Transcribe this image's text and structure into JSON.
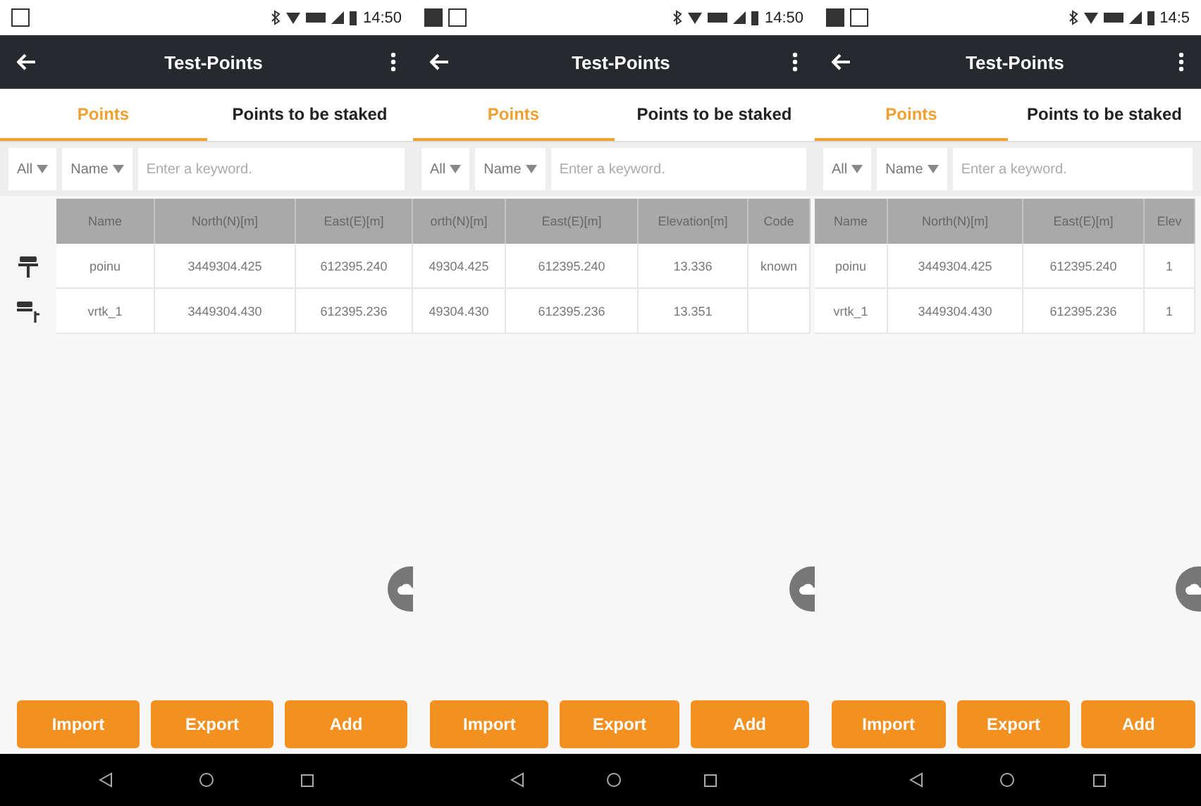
{
  "panels": [
    {
      "status": {
        "left_icons": [
          {
            "kind": "square"
          }
        ],
        "time": "14:50"
      },
      "title": "Test-Points",
      "tabs": [
        {
          "label": "Points",
          "selected": true
        },
        {
          "label": "Points to be staked",
          "selected": false
        }
      ],
      "filter": {
        "type": "All",
        "field": "Name",
        "placeholder": "Enter a keyword."
      },
      "columns": [
        "Name",
        "North(N)[m]",
        "East(E)[m]"
      ],
      "rows": [
        {
          "kind": "base",
          "cells": [
            "poinu",
            "3449304.425",
            "612395.240"
          ]
        },
        {
          "kind": "rover",
          "cells": [
            "vrtk_1",
            "3449304.430",
            "612395.236"
          ]
        }
      ],
      "buttons": [
        "Import",
        "Export",
        "Add"
      ]
    },
    {
      "status": {
        "left_icons": [
          {
            "kind": "image"
          },
          {
            "kind": "square"
          }
        ],
        "time": "14:50"
      },
      "title": "Test-Points",
      "tabs": [
        {
          "label": "Points",
          "selected": true
        },
        {
          "label": "Points to be staked",
          "selected": false
        }
      ],
      "filter": {
        "type": "All",
        "field": "Name",
        "placeholder": "Enter a keyword."
      },
      "columns": [
        "orth(N)[m]",
        "East(E)[m]",
        "Elevation[m]",
        "Code"
      ],
      "rows": [
        {
          "kind": "plain",
          "cells": [
            "49304.425",
            "612395.240",
            "13.336",
            "known"
          ]
        },
        {
          "kind": "plain",
          "cells": [
            "49304.430",
            "612395.236",
            "13.351",
            ""
          ]
        }
      ],
      "buttons": [
        "Import",
        "Export",
        "Add"
      ]
    },
    {
      "status": {
        "left_icons": [
          {
            "kind": "image"
          },
          {
            "kind": "square"
          }
        ],
        "time": "14:5"
      },
      "title": "Test-Points",
      "tabs": [
        {
          "label": "Points",
          "selected": true
        },
        {
          "label": "Points to be staked",
          "selected": false
        }
      ],
      "filter": {
        "type": "All",
        "field": "Name",
        "placeholder": "Enter a keyword."
      },
      "columns": [
        "Name",
        "North(N)[m]",
        "East(E)[m]",
        "Elev"
      ],
      "rows": [
        {
          "kind": "plain",
          "cells": [
            "poinu",
            "3449304.425",
            "612395.240",
            "1"
          ]
        },
        {
          "kind": "plain",
          "cells": [
            "vrtk_1",
            "3449304.430",
            "612395.236",
            "1"
          ]
        }
      ],
      "buttons": [
        "Import",
        "Export",
        "Add"
      ]
    }
  ]
}
